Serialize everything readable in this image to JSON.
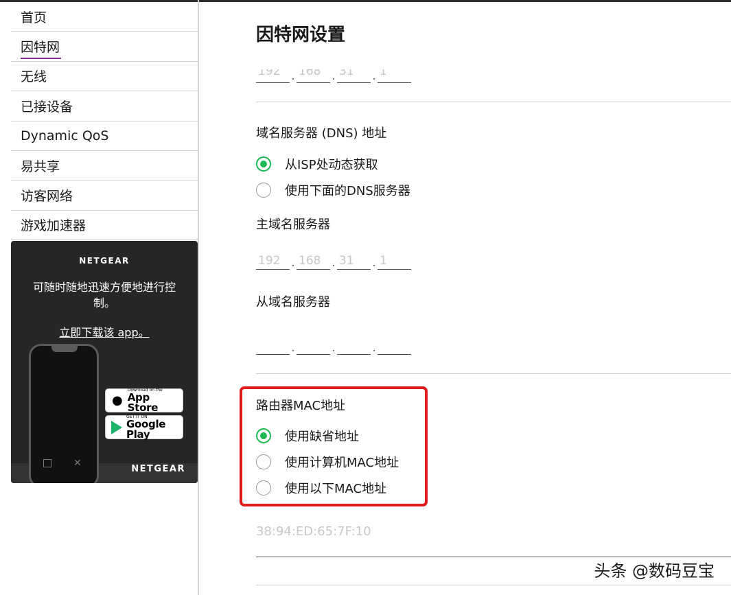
{
  "sidebar": {
    "items": [
      {
        "label": "首页"
      },
      {
        "label": "因特网"
      },
      {
        "label": "无线"
      },
      {
        "label": "已接设备"
      },
      {
        "label": "Dynamic QoS"
      },
      {
        "label": "易共享"
      },
      {
        "label": "访客网络"
      },
      {
        "label": "游戏加速器"
      }
    ],
    "active": "因特网"
  },
  "promo": {
    "brand": "NETGEAR",
    "text": "可随时随地迅速方便地进行控制。",
    "link": "立即下载该 app。",
    "app_store_small": "Download on the",
    "app_store_big": "App Store",
    "google_play_small": "GET IT ON",
    "google_play_big": "Google Play",
    "brand_bottom": "NETGEAR"
  },
  "main": {
    "title": "因特网设置",
    "top_ip": [
      "192",
      "168",
      "31",
      "1"
    ],
    "dns": {
      "label": "域名服务器 (DNS) 地址",
      "options": [
        {
          "label": "从ISP处动态获取",
          "checked": true
        },
        {
          "label": "使用下面的DNS服务器",
          "checked": false
        }
      ],
      "primary_label": "主域名服务器",
      "primary_ip": [
        "192",
        "168",
        "31",
        "1"
      ],
      "secondary_label": "从域名服务器",
      "secondary_ip": [
        "",
        "",
        "",
        ""
      ]
    },
    "mac": {
      "label": "路由器MAC地址",
      "options": [
        {
          "label": "使用缺省地址",
          "checked": true
        },
        {
          "label": "使用计算机MAC地址",
          "checked": false
        },
        {
          "label": "使用以下MAC地址",
          "checked": false
        }
      ],
      "value": "38:94:ED:65:7F:10"
    }
  },
  "watermark": "头条 @数码豆宝",
  "colors": {
    "accent_green": "#1db954",
    "highlight_red": "#e01b1b",
    "active_underline": "#7a2e8a"
  }
}
